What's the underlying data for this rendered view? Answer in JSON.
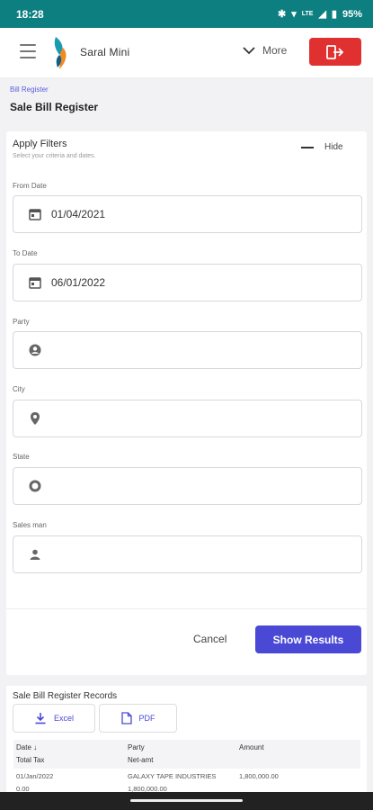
{
  "status": {
    "time": "18:28",
    "lte": "LTE",
    "battery": "95%"
  },
  "header": {
    "brand": "Saral Mini",
    "more_label": "More"
  },
  "breadcrumb": "Bill Register",
  "page_title": "Sale Bill Register",
  "filters": {
    "title": "Apply Filters",
    "subtitle": "Select your criteria and dates.",
    "hide_label": "Hide",
    "from_date": {
      "label": "From Date",
      "value": "01/04/2021"
    },
    "to_date": {
      "label": "To Date",
      "value": "06/01/2022"
    },
    "party": {
      "label": "Party",
      "value": ""
    },
    "city": {
      "label": "City",
      "value": ""
    },
    "state": {
      "label": "State",
      "value": ""
    },
    "salesman": {
      "label": "Sales man",
      "value": ""
    },
    "cancel_label": "Cancel",
    "show_label": "Show Results"
  },
  "records": {
    "title": "Sale Bill Register Records",
    "excel_label": "Excel",
    "pdf_label": "PDF",
    "columns": {
      "date": "Date",
      "total_tax": "Total Tax",
      "party": "Party",
      "net_amt": "Net-amt",
      "amount": "Amount"
    },
    "rows": [
      {
        "date": "01/Jan/2022",
        "party": "GALAXY TAPE INDUSTRIES",
        "amount": "1,800,000.00",
        "total_tax": "0.00",
        "net_amt": "1,800,000.00"
      }
    ]
  },
  "colors": {
    "statusbar": "#0e7f80",
    "accent": "#4a49d6",
    "logout": "#e03030"
  }
}
